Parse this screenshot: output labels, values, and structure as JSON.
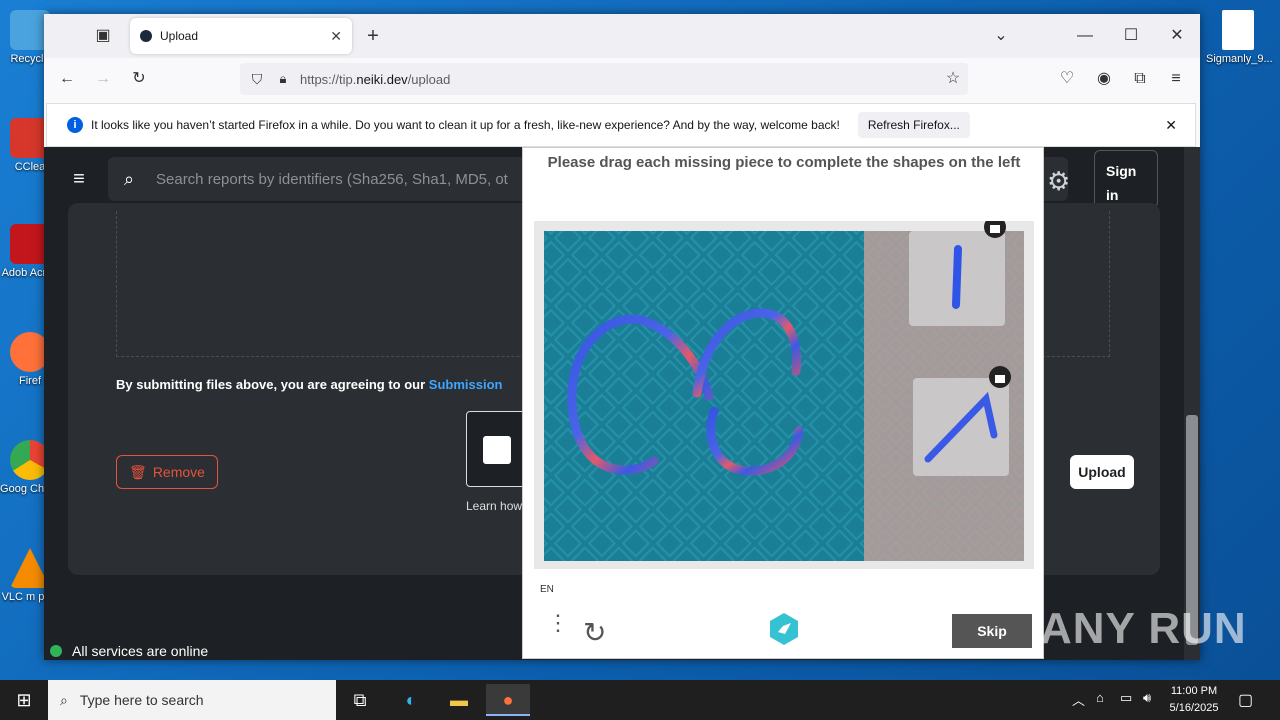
{
  "desktop": {
    "icons": [
      {
        "label": "Recycle",
        "color": "#4aa3df"
      },
      {
        "label": "CClea",
        "color": "#d7372a"
      },
      {
        "label": "Adob Acrob",
        "color": "#c3161c"
      },
      {
        "label": "Firef",
        "color": "#ff7139"
      },
      {
        "label": "Goog Chron",
        "color": "#34a853"
      },
      {
        "label": "VLC m play",
        "color": "#f48b00"
      },
      {
        "label": "Sigmanly_9...",
        "color": "#ffffff"
      }
    ]
  },
  "browser": {
    "tab_title": "Upload",
    "url_prefix": "https://tip.",
    "url_domain": "neiki.dev",
    "url_path": "/upload",
    "notification_text": "It looks like you haven’t started Firefox in a while. Do you want to clean it up for a fresh, like-new experience? And by the way, welcome back!",
    "notification_button": "Refresh Firefox..."
  },
  "page": {
    "search_placeholder": "Search reports by identifiers (Sha256, Sha1, MD5, ot",
    "sign_in": "Sign in",
    "agree_text": "By submitting files above, you are agreeing to our ",
    "agree_link": "Submission",
    "remove_label": "Remove",
    "upload_label": "Upload",
    "learn_text": "Learn how",
    "status_text": "All services are online"
  },
  "captcha": {
    "title": "Please drag each missing piece to complete the shapes on the left",
    "language": "EN",
    "skip_label": "Skip"
  },
  "taskbar": {
    "search_placeholder": "Type here to search",
    "time": "11:00 PM",
    "date": "5/16/2025"
  },
  "watermark": "ANY RUN"
}
